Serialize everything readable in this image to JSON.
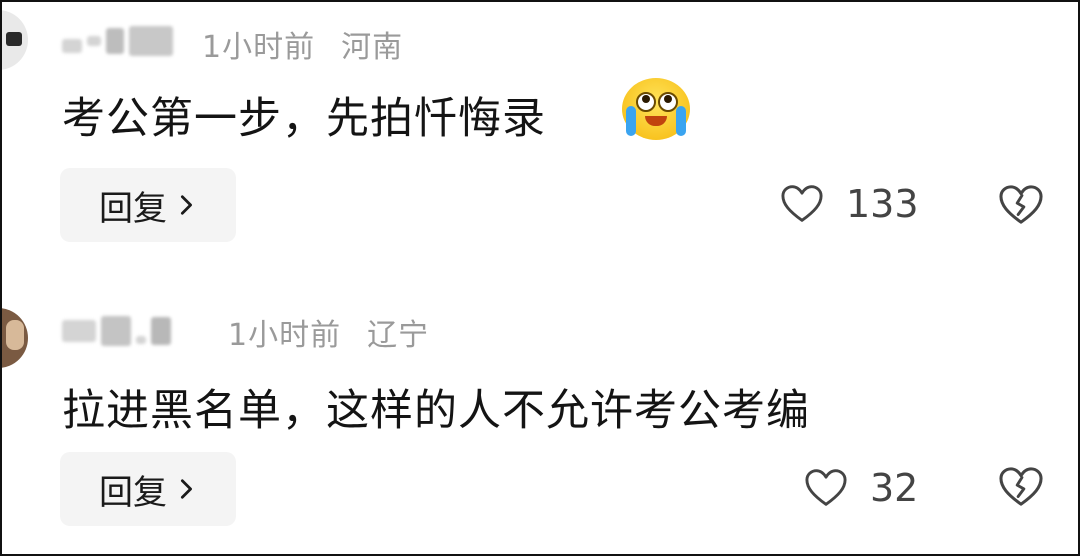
{
  "comments": [
    {
      "time": "1小时前",
      "location": "河南",
      "text": "考公第一步，先拍忏悔录",
      "emoji": "crying-emoji",
      "reply_label": "回复",
      "likes": "133"
    },
    {
      "time": "1小时前",
      "location": "辽宁",
      "text": "拉进黑名单，这样的人不允许考公考编",
      "reply_label": "回复",
      "likes": "32"
    }
  ],
  "icons": {
    "like": "heart-icon",
    "dislike": "broken-heart-icon",
    "reply_chevron": "chevron-right-icon"
  },
  "colors": {
    "meta_text": "#9a9a9a",
    "button_bg": "#f4f4f4"
  }
}
